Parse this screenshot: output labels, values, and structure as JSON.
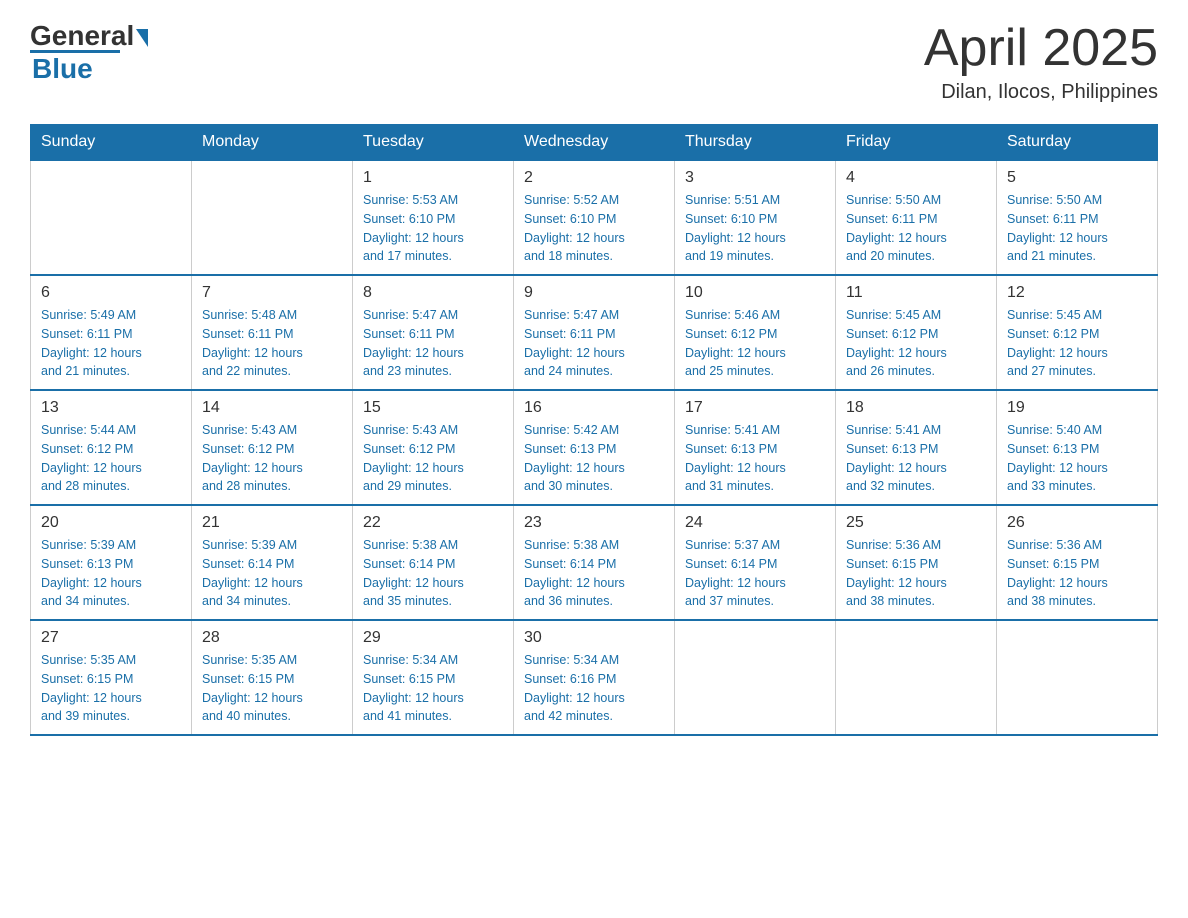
{
  "header": {
    "logo_general": "General",
    "logo_blue": "Blue",
    "month_year": "April 2025",
    "location": "Dilan, Ilocos, Philippines"
  },
  "days_of_week": [
    "Sunday",
    "Monday",
    "Tuesday",
    "Wednesday",
    "Thursday",
    "Friday",
    "Saturday"
  ],
  "weeks": [
    [
      {
        "day": "",
        "info": ""
      },
      {
        "day": "",
        "info": ""
      },
      {
        "day": "1",
        "info": "Sunrise: 5:53 AM\nSunset: 6:10 PM\nDaylight: 12 hours\nand 17 minutes."
      },
      {
        "day": "2",
        "info": "Sunrise: 5:52 AM\nSunset: 6:10 PM\nDaylight: 12 hours\nand 18 minutes."
      },
      {
        "day": "3",
        "info": "Sunrise: 5:51 AM\nSunset: 6:10 PM\nDaylight: 12 hours\nand 19 minutes."
      },
      {
        "day": "4",
        "info": "Sunrise: 5:50 AM\nSunset: 6:11 PM\nDaylight: 12 hours\nand 20 minutes."
      },
      {
        "day": "5",
        "info": "Sunrise: 5:50 AM\nSunset: 6:11 PM\nDaylight: 12 hours\nand 21 minutes."
      }
    ],
    [
      {
        "day": "6",
        "info": "Sunrise: 5:49 AM\nSunset: 6:11 PM\nDaylight: 12 hours\nand 21 minutes."
      },
      {
        "day": "7",
        "info": "Sunrise: 5:48 AM\nSunset: 6:11 PM\nDaylight: 12 hours\nand 22 minutes."
      },
      {
        "day": "8",
        "info": "Sunrise: 5:47 AM\nSunset: 6:11 PM\nDaylight: 12 hours\nand 23 minutes."
      },
      {
        "day": "9",
        "info": "Sunrise: 5:47 AM\nSunset: 6:11 PM\nDaylight: 12 hours\nand 24 minutes."
      },
      {
        "day": "10",
        "info": "Sunrise: 5:46 AM\nSunset: 6:12 PM\nDaylight: 12 hours\nand 25 minutes."
      },
      {
        "day": "11",
        "info": "Sunrise: 5:45 AM\nSunset: 6:12 PM\nDaylight: 12 hours\nand 26 minutes."
      },
      {
        "day": "12",
        "info": "Sunrise: 5:45 AM\nSunset: 6:12 PM\nDaylight: 12 hours\nand 27 minutes."
      }
    ],
    [
      {
        "day": "13",
        "info": "Sunrise: 5:44 AM\nSunset: 6:12 PM\nDaylight: 12 hours\nand 28 minutes."
      },
      {
        "day": "14",
        "info": "Sunrise: 5:43 AM\nSunset: 6:12 PM\nDaylight: 12 hours\nand 28 minutes."
      },
      {
        "day": "15",
        "info": "Sunrise: 5:43 AM\nSunset: 6:12 PM\nDaylight: 12 hours\nand 29 minutes."
      },
      {
        "day": "16",
        "info": "Sunrise: 5:42 AM\nSunset: 6:13 PM\nDaylight: 12 hours\nand 30 minutes."
      },
      {
        "day": "17",
        "info": "Sunrise: 5:41 AM\nSunset: 6:13 PM\nDaylight: 12 hours\nand 31 minutes."
      },
      {
        "day": "18",
        "info": "Sunrise: 5:41 AM\nSunset: 6:13 PM\nDaylight: 12 hours\nand 32 minutes."
      },
      {
        "day": "19",
        "info": "Sunrise: 5:40 AM\nSunset: 6:13 PM\nDaylight: 12 hours\nand 33 minutes."
      }
    ],
    [
      {
        "day": "20",
        "info": "Sunrise: 5:39 AM\nSunset: 6:13 PM\nDaylight: 12 hours\nand 34 minutes."
      },
      {
        "day": "21",
        "info": "Sunrise: 5:39 AM\nSunset: 6:14 PM\nDaylight: 12 hours\nand 34 minutes."
      },
      {
        "day": "22",
        "info": "Sunrise: 5:38 AM\nSunset: 6:14 PM\nDaylight: 12 hours\nand 35 minutes."
      },
      {
        "day": "23",
        "info": "Sunrise: 5:38 AM\nSunset: 6:14 PM\nDaylight: 12 hours\nand 36 minutes."
      },
      {
        "day": "24",
        "info": "Sunrise: 5:37 AM\nSunset: 6:14 PM\nDaylight: 12 hours\nand 37 minutes."
      },
      {
        "day": "25",
        "info": "Sunrise: 5:36 AM\nSunset: 6:15 PM\nDaylight: 12 hours\nand 38 minutes."
      },
      {
        "day": "26",
        "info": "Sunrise: 5:36 AM\nSunset: 6:15 PM\nDaylight: 12 hours\nand 38 minutes."
      }
    ],
    [
      {
        "day": "27",
        "info": "Sunrise: 5:35 AM\nSunset: 6:15 PM\nDaylight: 12 hours\nand 39 minutes."
      },
      {
        "day": "28",
        "info": "Sunrise: 5:35 AM\nSunset: 6:15 PM\nDaylight: 12 hours\nand 40 minutes."
      },
      {
        "day": "29",
        "info": "Sunrise: 5:34 AM\nSunset: 6:15 PM\nDaylight: 12 hours\nand 41 minutes."
      },
      {
        "day": "30",
        "info": "Sunrise: 5:34 AM\nSunset: 6:16 PM\nDaylight: 12 hours\nand 42 minutes."
      },
      {
        "day": "",
        "info": ""
      },
      {
        "day": "",
        "info": ""
      },
      {
        "day": "",
        "info": ""
      }
    ]
  ]
}
